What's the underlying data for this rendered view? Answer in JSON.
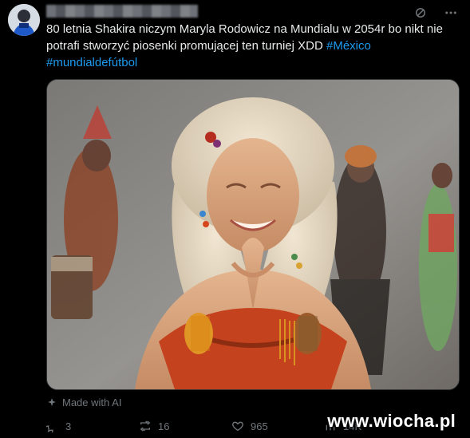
{
  "tweet": {
    "text": "80 letnia Shakira niczym Maryla Rodowicz na Mundialu w 2054r bo nikt nie potrafi stworzyć piosenki promującej ten turniej XDD",
    "hashtags": [
      "#México",
      "#mundialdefútbol"
    ]
  },
  "media_label": "Made with AI",
  "metrics": {
    "replies": "3",
    "reposts": "16",
    "likes": "965",
    "views": "14K"
  },
  "watermark": "www.wiocha.pl",
  "icons": {
    "top_actions": [
      "grok-icon",
      "more-icon"
    ],
    "metrics": [
      "reply-icon",
      "repost-icon",
      "like-icon",
      "views-icon"
    ]
  },
  "colors": {
    "background": "#000000",
    "text": "#e7e9ea",
    "muted": "#71767b",
    "link": "#1d9bf0"
  }
}
